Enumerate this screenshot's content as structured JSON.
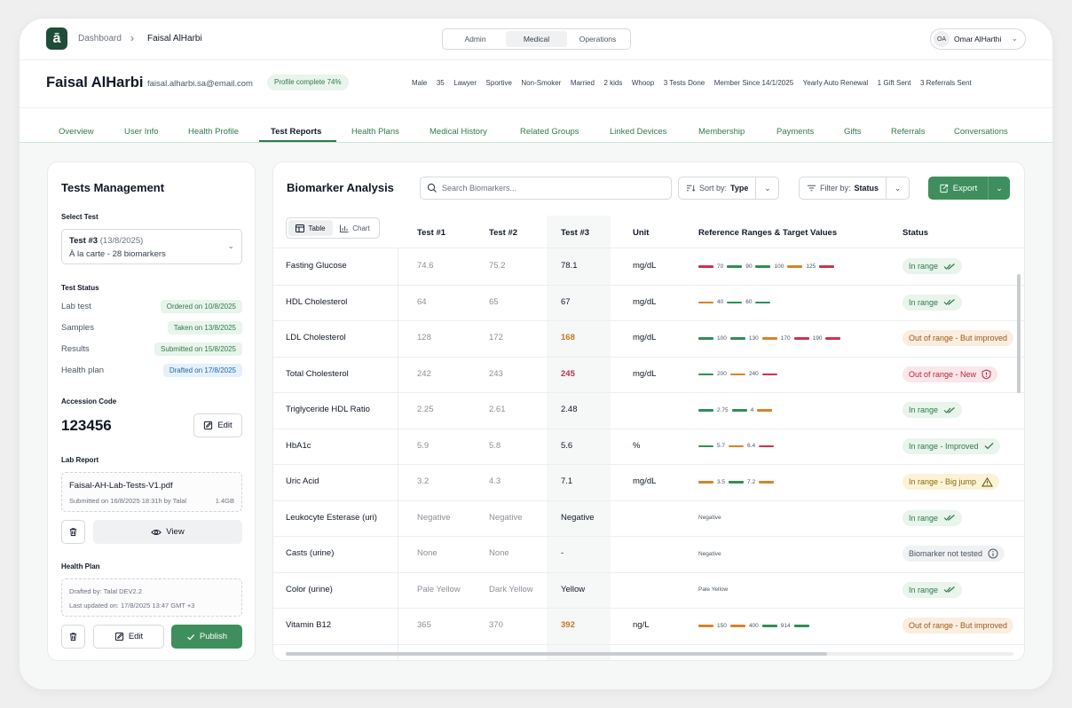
{
  "app": {
    "logo_char": "ā",
    "accent": "#3f8f5e",
    "brand": "#1e4d39"
  },
  "breadcrumb": {
    "root": "Dashboard",
    "sep": "›",
    "current": "Faisal AlHarbi"
  },
  "segments": [
    "Admin",
    "Medical",
    "Operations"
  ],
  "user": {
    "initials": "OA",
    "name": "Omar AlHarthi",
    "chevron": "⌄"
  },
  "profile": {
    "name": "Faisal AlHarbi",
    "email": "faisal.alharbi.sa@email.com",
    "completion": "Profile complete 74%",
    "attributes": [
      "Male",
      "35",
      "Lawyer",
      "Sportive",
      "Non-Smoker",
      "Married",
      "2 kids",
      "Whoop",
      "3 Tests Done",
      "Member Since 14/1/2025",
      "Yearly Auto Renewal",
      "1 Gift Sent",
      "3 Referrals Sent"
    ]
  },
  "tabs": [
    "Overview",
    "User Info",
    "Health Profile",
    "Test Reports",
    "Health Plans",
    "Medical History",
    "Related Groups",
    "Linked Devices",
    "Membership",
    "Payments",
    "Gifts",
    "Referrals",
    "Conversations"
  ],
  "left": {
    "title": "Tests Management",
    "select_label": "Select Test",
    "select": {
      "test": "Test #3",
      "date": "(13/8/2025)",
      "subtitle": "À la carte - 28 biomarkers",
      "chevron": "⌄"
    },
    "status_label": "Test Status",
    "statuses": [
      {
        "label": "Lab test",
        "badge": "Ordered on 10/8/2025"
      },
      {
        "label": "Samples",
        "badge": "Taken on 13/8/2025"
      },
      {
        "label": "Results",
        "badge": "Submitted on 15/8/2025"
      },
      {
        "label": "Health plan",
        "badge": "Drafted on 17/8/2025"
      }
    ],
    "accession_label": "Accession Code",
    "accession_code": "123456",
    "edit_label": "Edit",
    "lab_report_label": "Lab Report",
    "lab_report": {
      "file": "Faisal-AH-Lab-Tests-V1.pdf",
      "meta": "Submitted on 16/8/2025 18:31h by Talal",
      "size": "1.4GB"
    },
    "view_label": "View",
    "health_plan_label": "Health Plan",
    "health_plan": {
      "drafted_by": "Drafted by: Talal DEV2.2",
      "updated": "Last updated on: 17/8/2025 13:47 GMT +3"
    },
    "plan_edit_label": "Edit",
    "publish_label": "Publish"
  },
  "right": {
    "title": "Biomarker Analysis",
    "search_placeholder": "Search Biomarkers...",
    "sort": {
      "prefix": "Sort by:",
      "value": "Type",
      "chevron": "⌄"
    },
    "filter": {
      "prefix": "Filter by:",
      "value": "Status",
      "chevron": "⌄"
    },
    "export_label": "Export",
    "export_chevron": "⌄",
    "view_toggle": [
      "Table",
      "Chart"
    ],
    "headers": [
      "Test #1",
      "Test #2",
      "Test #3",
      "Unit",
      "Reference Ranges & Target Values",
      "Status"
    ],
    "rows": [
      {
        "name": "Fasting Glucose",
        "t1": "74.6",
        "t2": "75.2",
        "t3": "78.1",
        "t3_tone": "normal",
        "unit": "mg/dL",
        "range": [
          {
            "c": "r"
          },
          {
            "v": "70"
          },
          {
            "c": "g"
          },
          {
            "v": "90"
          },
          {
            "c": "g"
          },
          {
            "v": "100"
          },
          {
            "c": "o"
          },
          {
            "v": "125"
          },
          {
            "c": "r"
          }
        ],
        "status": "In range",
        "tone": "green",
        "status_icon": "double-check"
      },
      {
        "name": "HDL Cholesterol",
        "t1": "64",
        "t2": "65",
        "t3": "67",
        "t3_tone": "normal",
        "unit": "mg/dL",
        "range": [
          {
            "c": "o"
          },
          {
            "v": "40"
          },
          {
            "c": "g"
          },
          {
            "v": "60"
          },
          {
            "c": "g"
          }
        ],
        "status": "In range",
        "tone": "green",
        "status_icon": "double-check"
      },
      {
        "name": "LDL Cholesterol",
        "t1": "128",
        "t2": "172",
        "t3": "168",
        "t3_tone": "orange",
        "unit": "mg/dL",
        "range": [
          {
            "c": "g"
          },
          {
            "v": "100"
          },
          {
            "c": "g"
          },
          {
            "v": "130"
          },
          {
            "c": "o"
          },
          {
            "v": "170"
          },
          {
            "c": "r"
          },
          {
            "v": "190"
          },
          {
            "c": "r"
          }
        ],
        "status": "Out of range - But improved",
        "tone": "orange",
        "status_icon": ""
      },
      {
        "name": "Total Cholesterol",
        "t1": "242",
        "t2": "243",
        "t3": "245",
        "t3_tone": "red",
        "unit": "mg/dL",
        "range": [
          {
            "c": "g"
          },
          {
            "v": "200"
          },
          {
            "c": "o"
          },
          {
            "v": "240"
          },
          {
            "c": "r"
          }
        ],
        "status": "Out of range - New",
        "tone": "red",
        "status_icon": "shield-alert"
      },
      {
        "name": "Triglyceride HDL Ratio",
        "t1": "2.25",
        "t2": "2.61",
        "t3": "2.48",
        "t3_tone": "normal",
        "unit": "",
        "range": [
          {
            "c": "g"
          },
          {
            "v": "2.75"
          },
          {
            "c": "g"
          },
          {
            "v": "4"
          },
          {
            "c": "o"
          }
        ],
        "status": "In range",
        "tone": "green",
        "status_icon": "double-check"
      },
      {
        "name": "HbA1c",
        "t1": "5.9",
        "t2": "5.8",
        "t3": "5.6",
        "t3_tone": "normal",
        "unit": "%",
        "range": [
          {
            "c": "g"
          },
          {
            "v": "5.7"
          },
          {
            "c": "o"
          },
          {
            "v": "6.4"
          },
          {
            "c": "r"
          }
        ],
        "status": "In range - Improved",
        "tone": "green",
        "status_icon": "check"
      },
      {
        "name": "Uric Acid",
        "t1": "3.2",
        "t2": "4.3",
        "t3": "7.1",
        "t3_tone": "normal",
        "unit": "mg/dL",
        "range": [
          {
            "c": "o"
          },
          {
            "v": "3.5"
          },
          {
            "c": "g"
          },
          {
            "v": "7.2"
          },
          {
            "c": "o"
          }
        ],
        "status": "In range - Big jump",
        "tone": "yellow",
        "status_icon": "warning"
      },
      {
        "name": "Leukocyte Esterase (uri)",
        "t1": "Negative",
        "t2": "Negative",
        "t3": "Negative",
        "t3_tone": "normal",
        "unit": "",
        "range": [
          {
            "v": "Negative"
          }
        ],
        "status": "In range",
        "tone": "green",
        "status_icon": "double-check"
      },
      {
        "name": "Casts (urine)",
        "t1": "None",
        "t2": "None",
        "t3": "-",
        "t3_tone": "normal",
        "unit": "",
        "range": [
          {
            "v": "Negative"
          }
        ],
        "status": "Biomarker not tested",
        "tone": "gray",
        "status_icon": "info"
      },
      {
        "name": "Color (urine)",
        "t1": "Pale Yellow",
        "t2": "Dark Yellow",
        "t3": "Yellow",
        "t3_tone": "normal",
        "unit": "",
        "range": [
          {
            "v": "Pale Yellow"
          }
        ],
        "status": "In range",
        "tone": "green",
        "status_icon": "double-check"
      },
      {
        "name": "Vitamin B12",
        "t1": "365",
        "t2": "370",
        "t3": "392",
        "t3_tone": "orange",
        "unit": "ng/L",
        "range": [
          {
            "c": "o"
          },
          {
            "v": "150"
          },
          {
            "c": "o"
          },
          {
            "v": "400"
          },
          {
            "c": "g"
          },
          {
            "v": "914"
          },
          {
            "c": "g"
          }
        ],
        "status": "Out of range - But improved",
        "tone": "orange",
        "status_icon": ""
      }
    ]
  }
}
